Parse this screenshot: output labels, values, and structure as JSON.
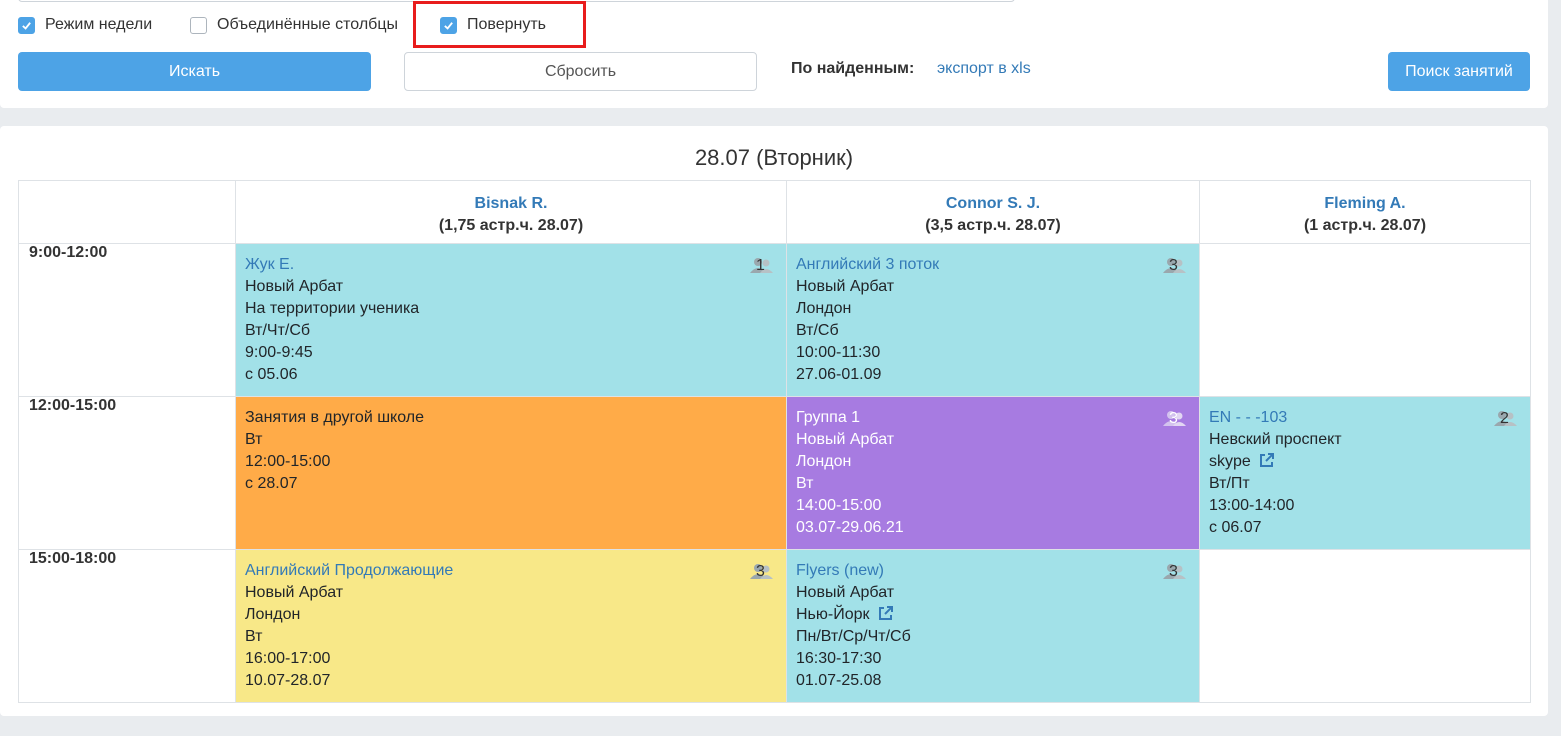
{
  "filters": {
    "week_mode": {
      "label": "Режим недели",
      "checked": true
    },
    "merged_columns": {
      "label": "Объединённые столбцы",
      "checked": false
    },
    "rotate": {
      "label": "Повернуть",
      "checked": true
    }
  },
  "buttons": {
    "search": "Искать",
    "reset": "Сбросить",
    "found_label": "По найденным:",
    "export": "экспорт в xls",
    "lesson_search": "Поиск занятий"
  },
  "colors": {
    "primary": "#4da3e6",
    "highlight": "#e81c1c",
    "cyan": "#a2e1e8",
    "orange": "#ffab48",
    "purple": "#a77be1",
    "yellow": "#f8e888"
  },
  "schedule": {
    "date_title": "28.07 (Вторник)",
    "teachers": [
      {
        "name": "Bisnak R.",
        "hours": "(1,75 астр.ч. 28.07)"
      },
      {
        "name": "Connor S. J.",
        "hours": "(3,5 астр.ч. 28.07)"
      },
      {
        "name": "Fleming A.",
        "hours": "(1 астр.ч. 28.07)"
      }
    ],
    "times": [
      "9:00-12:00",
      "12:00-15:00",
      "15:00-18:00"
    ],
    "cells": {
      "r0c0": {
        "title": "Жук Е.",
        "lines": [
          "Новый Арбат",
          "На территории ученика",
          "Вт/Чт/Сб",
          "9:00-9:45",
          "с 05.06"
        ],
        "count": "1"
      },
      "r0c1": {
        "title": "Английский 3 поток",
        "lines": [
          "Новый Арбат",
          "Лондон",
          "Вт/Сб",
          "10:00-11:30",
          "27.06-01.09"
        ],
        "count": "3"
      },
      "r1c0": {
        "title": "Занятия в другой школе",
        "lines": [
          "Вт",
          "12:00-15:00",
          "с 28.07"
        ]
      },
      "r1c1": {
        "title": "Группа 1",
        "lines": [
          "Новый Арбат",
          "Лондон",
          "Вт",
          "14:00-15:00",
          "03.07-29.06.21"
        ],
        "count": "3"
      },
      "r1c2": {
        "title": "EN - - -103",
        "lines": [
          "Невский проспект",
          "skype",
          "Вт/Пт",
          "13:00-14:00",
          "с 06.07"
        ],
        "count": "2"
      },
      "r2c0": {
        "title": "Английский Продолжающие",
        "lines": [
          "Новый Арбат",
          "Лондон",
          "Вт",
          "16:00-17:00",
          "10.07-28.07"
        ],
        "count": "3"
      },
      "r2c1": {
        "title": "Flyers (new)",
        "lines": [
          "Новый Арбат",
          "Нью-Йорк",
          "Пн/Вт/Ср/Чт/Сб",
          "16:30-17:30",
          "01.07-25.08"
        ],
        "count": "3"
      }
    }
  }
}
